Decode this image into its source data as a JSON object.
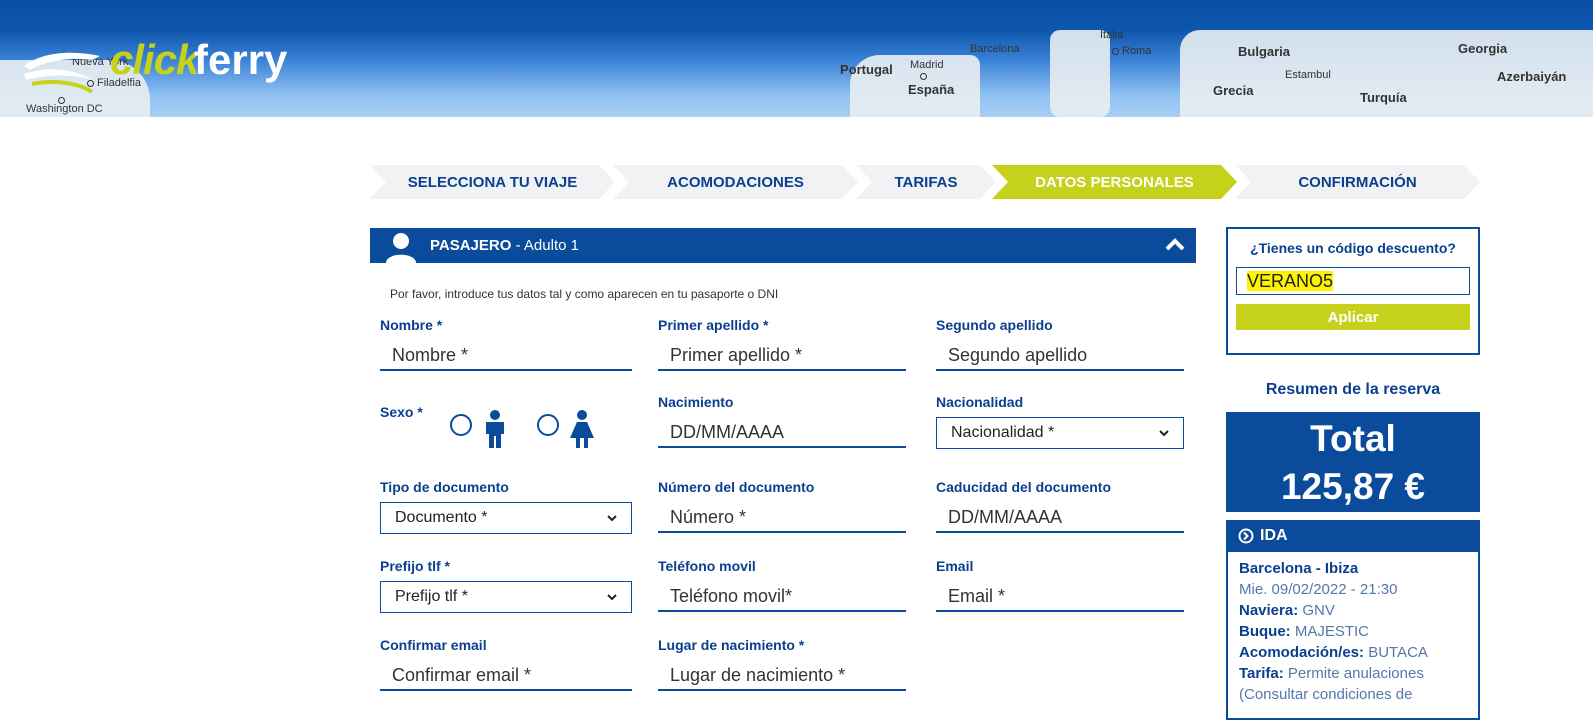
{
  "header": {
    "logo": {
      "click": "click",
      "ferry": "ferry"
    },
    "map_labels": {
      "nueva_york": "Nueva York",
      "filadelfia": "Filadelfia",
      "washington": "Washington DC",
      "portugal": "Portugal",
      "madrid": "Madrid",
      "espana": "España",
      "barcelona": "Barcelona",
      "italia": "Italia",
      "roma": "Roma",
      "bulgaria": "Bulgaria",
      "estambul": "Estambul",
      "grecia": "Grecia",
      "turquia": "Turquía",
      "georgia": "Georgia",
      "azerbaiyan": "Azerbaiyán"
    }
  },
  "steps": [
    {
      "label": "SELECCIONA TU VIAJE",
      "active": false
    },
    {
      "label": "ACOMODACIONES",
      "active": false
    },
    {
      "label": "TARIFAS",
      "active": false
    },
    {
      "label": "DATOS PERSONALES",
      "active": true
    },
    {
      "label": "CONFIRMACIÓN",
      "active": false
    }
  ],
  "passenger": {
    "title_bold": "PASAJERO",
    "title_rest": " - Adulto 1",
    "instructions": "Por favor, introduce tus datos tal y como aparecen en tu pasaporte o DNI",
    "fields": {
      "nombre": {
        "label": "Nombre *",
        "placeholder": "Nombre *"
      },
      "primer_apellido": {
        "label": "Primer apellido *",
        "placeholder": "Primer apellido *"
      },
      "segundo_apellido": {
        "label": "Segundo apellido",
        "placeholder": "Segundo apellido"
      },
      "sexo": {
        "label": "Sexo *"
      },
      "nacimiento": {
        "label": "Nacimiento",
        "placeholder": "DD/MM/AAAA"
      },
      "nacionalidad": {
        "label": "Nacionalidad",
        "selected": "Nacionalidad *"
      },
      "tipo_documento": {
        "label": "Tipo de documento",
        "selected": "Documento *"
      },
      "numero_documento": {
        "label": "Número del documento",
        "placeholder": "Número *"
      },
      "caducidad": {
        "label": "Caducidad del documento",
        "placeholder": "DD/MM/AAAA"
      },
      "prefijo": {
        "label": "Prefijo tlf *",
        "selected": "Prefijo tlf *"
      },
      "telefono": {
        "label": "Teléfono movil",
        "placeholder": "Teléfono movil*"
      },
      "email": {
        "label": "Email",
        "placeholder": "Email *"
      },
      "confirmar_email": {
        "label": "Confirmar email",
        "placeholder": "Confirmar email *"
      },
      "lugar_nacimiento": {
        "label": "Lugar de nacimiento *",
        "placeholder": "Lugar de nacimiento *"
      }
    }
  },
  "discount": {
    "question": "¿Tienes un código descuento?",
    "code": "VERANO5",
    "apply_label": "Aplicar"
  },
  "summary": {
    "title": "Resumen de la reserva",
    "total_label": "Total",
    "total_value": "125,87 €",
    "ida": {
      "label": "IDA",
      "route": "Barcelona - Ibiza",
      "datetime": "Mie. 09/02/2022 - 21:30",
      "naviera_label": "Naviera:",
      "naviera": "GNV",
      "buque_label": "Buque:",
      "buque": "MAJESTIC",
      "acomodacion_label": "Acomodación/es:",
      "acomodacion": "BUTACA",
      "tarifa_label": "Tarifa:",
      "tarifa": "Permite anulaciones (Consultar condiciones de"
    }
  },
  "colors": {
    "primary": "#0b4b9b",
    "accent": "#c5d11b",
    "step_bg": "#f1f2f3",
    "highlight": "#fff200"
  }
}
